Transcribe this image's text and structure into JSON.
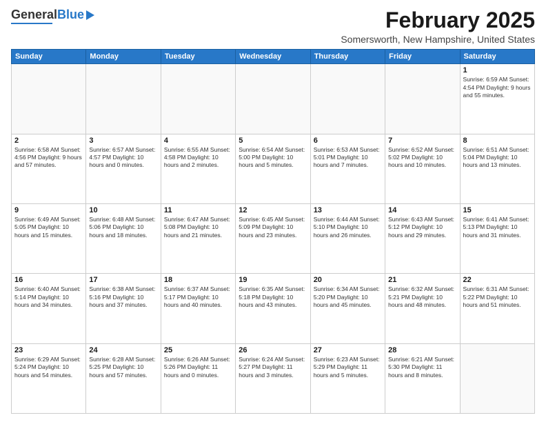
{
  "header": {
    "logo_general": "General",
    "logo_blue": "Blue",
    "month_title": "February 2025",
    "location": "Somersworth, New Hampshire, United States"
  },
  "weekdays": [
    "Sunday",
    "Monday",
    "Tuesday",
    "Wednesday",
    "Thursday",
    "Friday",
    "Saturday"
  ],
  "weeks": [
    [
      {
        "day": "",
        "info": ""
      },
      {
        "day": "",
        "info": ""
      },
      {
        "day": "",
        "info": ""
      },
      {
        "day": "",
        "info": ""
      },
      {
        "day": "",
        "info": ""
      },
      {
        "day": "",
        "info": ""
      },
      {
        "day": "1",
        "info": "Sunrise: 6:59 AM\nSunset: 4:54 PM\nDaylight: 9 hours and 55 minutes."
      }
    ],
    [
      {
        "day": "2",
        "info": "Sunrise: 6:58 AM\nSunset: 4:56 PM\nDaylight: 9 hours and 57 minutes."
      },
      {
        "day": "3",
        "info": "Sunrise: 6:57 AM\nSunset: 4:57 PM\nDaylight: 10 hours and 0 minutes."
      },
      {
        "day": "4",
        "info": "Sunrise: 6:55 AM\nSunset: 4:58 PM\nDaylight: 10 hours and 2 minutes."
      },
      {
        "day": "5",
        "info": "Sunrise: 6:54 AM\nSunset: 5:00 PM\nDaylight: 10 hours and 5 minutes."
      },
      {
        "day": "6",
        "info": "Sunrise: 6:53 AM\nSunset: 5:01 PM\nDaylight: 10 hours and 7 minutes."
      },
      {
        "day": "7",
        "info": "Sunrise: 6:52 AM\nSunset: 5:02 PM\nDaylight: 10 hours and 10 minutes."
      },
      {
        "day": "8",
        "info": "Sunrise: 6:51 AM\nSunset: 5:04 PM\nDaylight: 10 hours and 13 minutes."
      }
    ],
    [
      {
        "day": "9",
        "info": "Sunrise: 6:49 AM\nSunset: 5:05 PM\nDaylight: 10 hours and 15 minutes."
      },
      {
        "day": "10",
        "info": "Sunrise: 6:48 AM\nSunset: 5:06 PM\nDaylight: 10 hours and 18 minutes."
      },
      {
        "day": "11",
        "info": "Sunrise: 6:47 AM\nSunset: 5:08 PM\nDaylight: 10 hours and 21 minutes."
      },
      {
        "day": "12",
        "info": "Sunrise: 6:45 AM\nSunset: 5:09 PM\nDaylight: 10 hours and 23 minutes."
      },
      {
        "day": "13",
        "info": "Sunrise: 6:44 AM\nSunset: 5:10 PM\nDaylight: 10 hours and 26 minutes."
      },
      {
        "day": "14",
        "info": "Sunrise: 6:43 AM\nSunset: 5:12 PM\nDaylight: 10 hours and 29 minutes."
      },
      {
        "day": "15",
        "info": "Sunrise: 6:41 AM\nSunset: 5:13 PM\nDaylight: 10 hours and 31 minutes."
      }
    ],
    [
      {
        "day": "16",
        "info": "Sunrise: 6:40 AM\nSunset: 5:14 PM\nDaylight: 10 hours and 34 minutes."
      },
      {
        "day": "17",
        "info": "Sunrise: 6:38 AM\nSunset: 5:16 PM\nDaylight: 10 hours and 37 minutes."
      },
      {
        "day": "18",
        "info": "Sunrise: 6:37 AM\nSunset: 5:17 PM\nDaylight: 10 hours and 40 minutes."
      },
      {
        "day": "19",
        "info": "Sunrise: 6:35 AM\nSunset: 5:18 PM\nDaylight: 10 hours and 43 minutes."
      },
      {
        "day": "20",
        "info": "Sunrise: 6:34 AM\nSunset: 5:20 PM\nDaylight: 10 hours and 45 minutes."
      },
      {
        "day": "21",
        "info": "Sunrise: 6:32 AM\nSunset: 5:21 PM\nDaylight: 10 hours and 48 minutes."
      },
      {
        "day": "22",
        "info": "Sunrise: 6:31 AM\nSunset: 5:22 PM\nDaylight: 10 hours and 51 minutes."
      }
    ],
    [
      {
        "day": "23",
        "info": "Sunrise: 6:29 AM\nSunset: 5:24 PM\nDaylight: 10 hours and 54 minutes."
      },
      {
        "day": "24",
        "info": "Sunrise: 6:28 AM\nSunset: 5:25 PM\nDaylight: 10 hours and 57 minutes."
      },
      {
        "day": "25",
        "info": "Sunrise: 6:26 AM\nSunset: 5:26 PM\nDaylight: 11 hours and 0 minutes."
      },
      {
        "day": "26",
        "info": "Sunrise: 6:24 AM\nSunset: 5:27 PM\nDaylight: 11 hours and 3 minutes."
      },
      {
        "day": "27",
        "info": "Sunrise: 6:23 AM\nSunset: 5:29 PM\nDaylight: 11 hours and 5 minutes."
      },
      {
        "day": "28",
        "info": "Sunrise: 6:21 AM\nSunset: 5:30 PM\nDaylight: 11 hours and 8 minutes."
      },
      {
        "day": "",
        "info": ""
      }
    ]
  ]
}
